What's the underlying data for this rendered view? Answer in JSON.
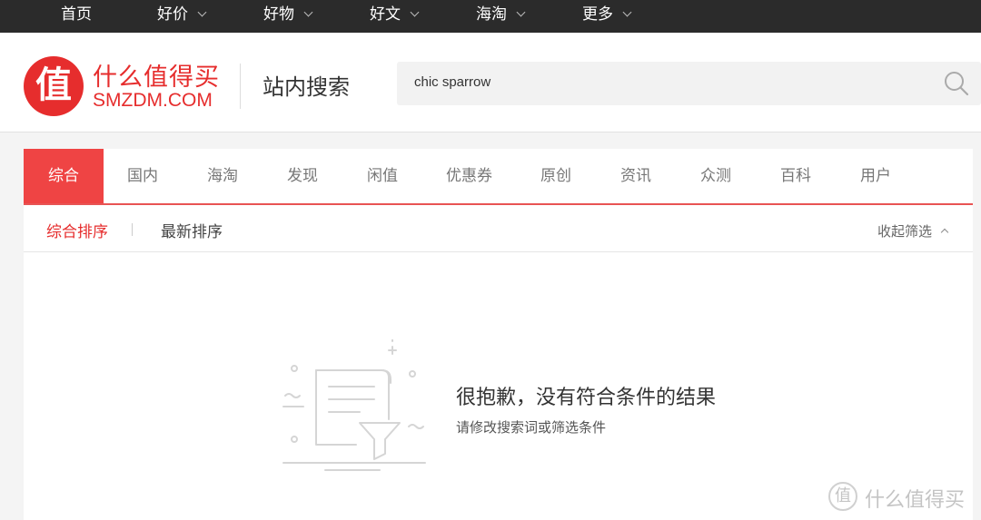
{
  "topnav": {
    "items": [
      {
        "label": "首页",
        "dropdown": false
      },
      {
        "label": "好价",
        "dropdown": true
      },
      {
        "label": "好物",
        "dropdown": true
      },
      {
        "label": "好文",
        "dropdown": true
      },
      {
        "label": "海淘",
        "dropdown": true
      },
      {
        "label": "更多",
        "dropdown": true
      }
    ]
  },
  "header": {
    "logo_glyph": "值",
    "brand_cn": "什么值得买",
    "brand_en": "SMZDM.COM",
    "section_title": "站内搜索",
    "search": {
      "value": "chic sparrow",
      "icon": "search-icon"
    }
  },
  "tabs": [
    "综合",
    "国内",
    "海淘",
    "发现",
    "闲值",
    "优惠券",
    "原创",
    "资讯",
    "众测",
    "百科",
    "用户"
  ],
  "active_tab": "综合",
  "sort": {
    "active_label": "综合排序",
    "other_label": "最新排序",
    "collapse_label": "收起筛选"
  },
  "empty_state": {
    "title": "很抱歉，没有符合条件的结果",
    "subtitle": "请修改搜索词或筛选条件"
  },
  "watermark": {
    "glyph": "值",
    "text": "什么值得买"
  },
  "colors": {
    "accent": "#e62d2d",
    "tab_active_bg": "#ef4444",
    "topnav_bg": "#2b2b2b"
  }
}
